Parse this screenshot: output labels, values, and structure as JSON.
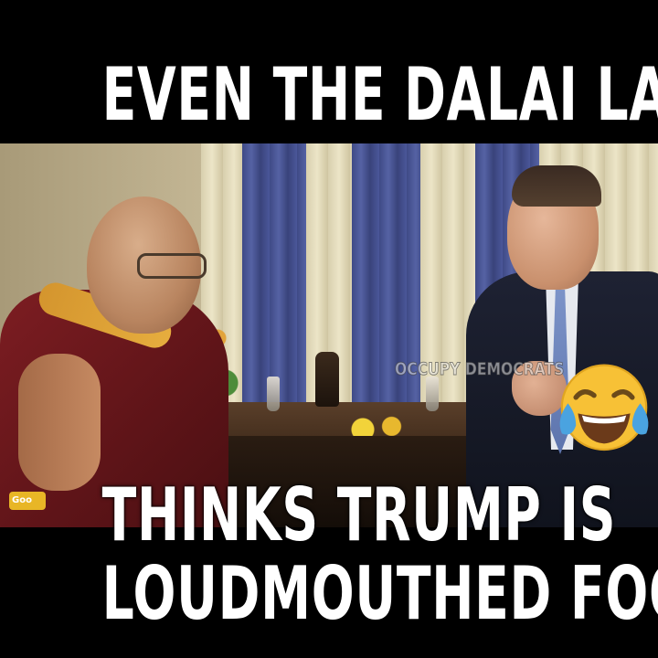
{
  "meme": {
    "top_caption": "EVEN THE DALAI LAMA",
    "bottom_caption_line1": "THINKS TRUMP IS",
    "bottom_caption_line2": "LOUDMOUTHED FOOL"
  },
  "video": {
    "watermark": "OCCUPY DEMOCRATS",
    "channel_logo_text": "Goo",
    "emoji_icon": "face-with-tears-of-joy-icon"
  },
  "colors": {
    "background": "#000000",
    "caption_text": "#ffffff",
    "robe": "#7d1d22",
    "sash": "#d4952e",
    "curtain_blue": "#4b579a",
    "emoji_yellow": "#f7c136",
    "tear_blue": "#4aa3e0"
  }
}
